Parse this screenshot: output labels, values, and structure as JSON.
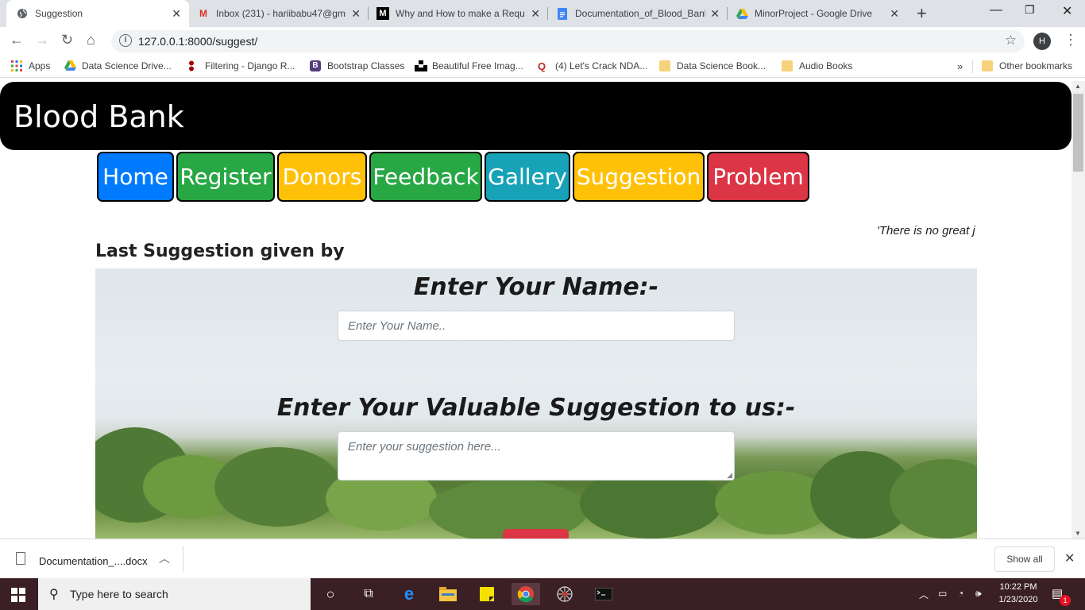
{
  "browser": {
    "tabs": [
      {
        "title": "Suggestion",
        "active": true
      },
      {
        "title": "Inbox (231) - hariibabu47@gm"
      },
      {
        "title": "Why and How to make a Requ"
      },
      {
        "title": "Documentation_of_Blood_Bank"
      },
      {
        "title": "MinorProject - Google Drive"
      }
    ],
    "url": "127.0.0.1:8000/suggest/",
    "profile_initial": "H",
    "bookmarks": [
      {
        "label": "Apps",
        "icon": "apps-grid-icon"
      },
      {
        "label": "Data Science Drive...",
        "icon": "drive-icon"
      },
      {
        "label": "Filtering - Django R...",
        "icon": "django-icon"
      },
      {
        "label": "Bootstrap Classes",
        "icon": "bootstrap-icon"
      },
      {
        "label": "Beautiful Free Imag...",
        "icon": "unsplash-icon"
      },
      {
        "label": "(4) Let's Crack NDA...",
        "icon": "quora-icon"
      },
      {
        "label": "Data Science Book...",
        "icon": "folder-icon"
      },
      {
        "label": "Audio Books",
        "icon": "folder-icon"
      },
      {
        "label": "Other bookmarks",
        "icon": "folder-icon"
      }
    ],
    "bookmarks_overflow": "»"
  },
  "page": {
    "brand": "Blood Bank",
    "nav": [
      {
        "label": "Home",
        "color": "#007bff"
      },
      {
        "label": "Register",
        "color": "#28a745"
      },
      {
        "label": "Donors",
        "color": "#ffc107"
      },
      {
        "label": "Feedback",
        "color": "#28a745"
      },
      {
        "label": "Gallery",
        "color": "#17a2b8"
      },
      {
        "label": "Suggestion",
        "color": "#ffc107"
      },
      {
        "label": "Problem",
        "color": "#dc3545"
      }
    ],
    "marquee_quote": "'There is no great j",
    "last_suggestion_heading": "Last Suggestion given by",
    "name_label": "Enter Your Name:-",
    "name_placeholder": "Enter Your Name..",
    "suggestion_label": "Enter Your Valuable Suggestion to us:-",
    "suggestion_placeholder": "Enter your suggestion here...",
    "submit_color": "#dc3545"
  },
  "download_shelf": {
    "file_name": "Documentation_....docx",
    "show_all": "Show all"
  },
  "taskbar": {
    "search_placeholder": "Type here to search",
    "time": "10:22 PM",
    "date": "1/23/2020",
    "notification_count": "1"
  }
}
